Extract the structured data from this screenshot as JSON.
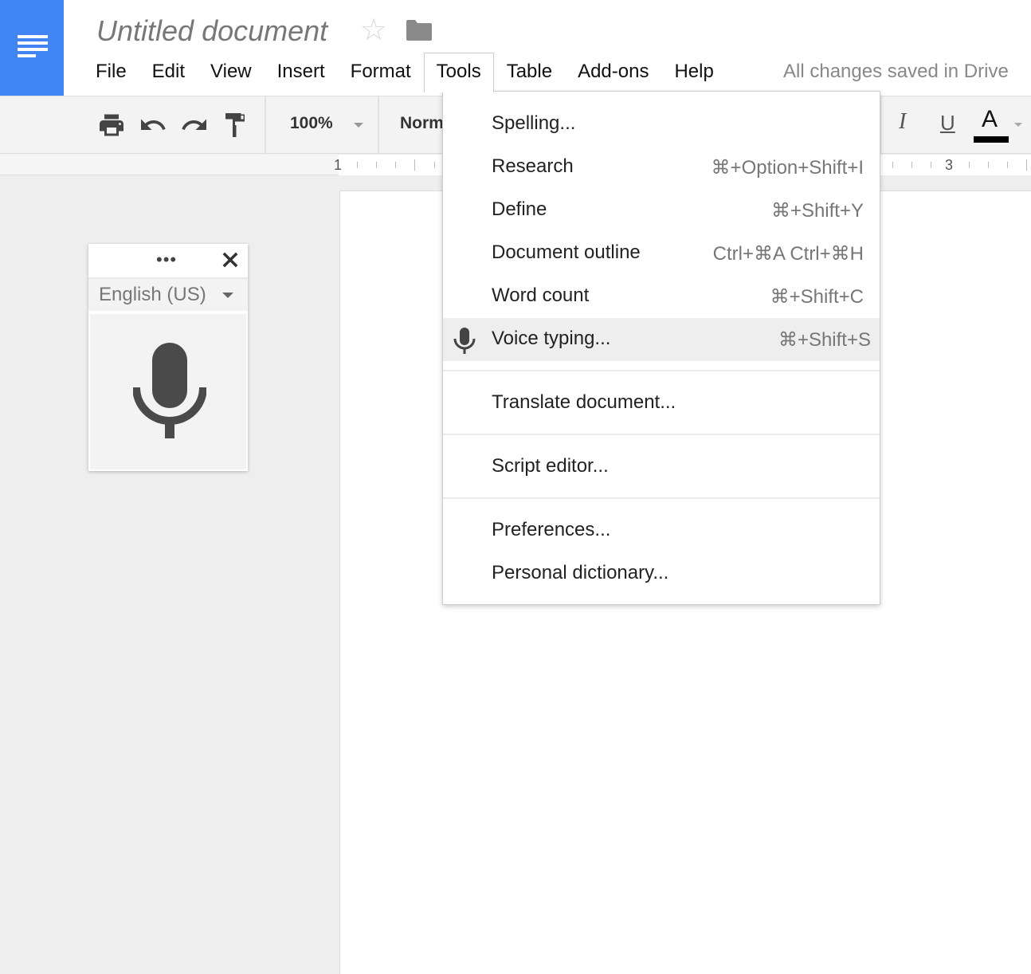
{
  "app": {
    "title": "Untitled document",
    "save_status": "All changes saved in Drive",
    "brand_color": "#4285f4"
  },
  "icons": {
    "logo": "docs-logo-icon",
    "star": "star-icon",
    "folder": "folder-icon",
    "star_glyph": "☆"
  },
  "menubar": {
    "items": [
      {
        "label": "File"
      },
      {
        "label": "Edit"
      },
      {
        "label": "View"
      },
      {
        "label": "Insert"
      },
      {
        "label": "Format"
      },
      {
        "label": "Tools",
        "active": true
      },
      {
        "label": "Table"
      },
      {
        "label": "Add-ons"
      },
      {
        "label": "Help"
      }
    ]
  },
  "toolbar": {
    "zoom": "100%",
    "style": "Normal text",
    "italic": "I",
    "underline": "U",
    "text_color": "A"
  },
  "ruler": {
    "labels": [
      "1",
      "3"
    ]
  },
  "tools_menu": {
    "items": [
      {
        "label": "Spelling...",
        "shortcut": ""
      },
      {
        "label": "Research",
        "shortcut": "⌘+Option+Shift+I"
      },
      {
        "label": "Define",
        "shortcut": "⌘+Shift+Y"
      },
      {
        "label": "Document outline",
        "shortcut": "Ctrl+⌘A Ctrl+⌘H"
      },
      {
        "label": "Word count",
        "shortcut": "⌘+Shift+C"
      },
      {
        "label": "Voice typing...",
        "shortcut": "⌘+Shift+S",
        "highlighted": true,
        "icon": "microphone-icon"
      },
      {
        "label": "Translate document...",
        "shortcut": ""
      },
      {
        "label": "Script editor...",
        "shortcut": ""
      },
      {
        "label": "Preferences...",
        "shortcut": ""
      },
      {
        "label": "Personal dictionary...",
        "shortcut": ""
      }
    ]
  },
  "voice_panel": {
    "drag_handle": "•••",
    "language": "English (US)"
  }
}
